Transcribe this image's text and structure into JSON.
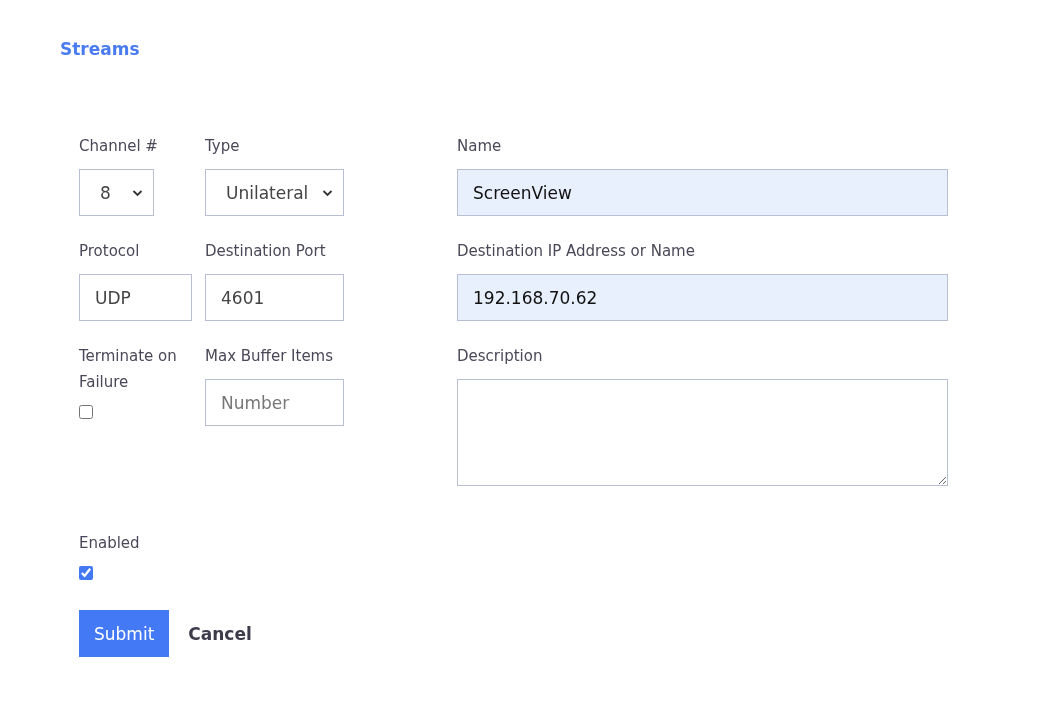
{
  "title": "Streams",
  "left_rows": [
    [
      {
        "label": "Channel #",
        "kind": "select",
        "value": "8"
      },
      {
        "label": "Type",
        "kind": "select",
        "value": "Unilateral"
      }
    ],
    [
      {
        "label": "Protocol",
        "kind": "text",
        "value": "UDP",
        "autofilled": false
      },
      {
        "label": "Destination Port",
        "kind": "text",
        "value": "4601",
        "autofilled": false
      }
    ],
    [
      {
        "label": "Terminate on Failure",
        "kind": "checkbox",
        "checked": false
      },
      {
        "label": "Max Buffer Items",
        "kind": "text",
        "placeholder": "Number",
        "autofilled": false
      }
    ]
  ],
  "right_fields": [
    {
      "label": "Name",
      "kind": "text",
      "value": "ScreenView",
      "autofilled": true
    },
    {
      "label": "Destination IP Address or Name",
      "kind": "text",
      "value": "192.168.70.62",
      "autofilled": true
    },
    {
      "label": "Description",
      "kind": "textarea"
    }
  ],
  "enabled": {
    "label": "Enabled",
    "checked": true
  },
  "buttons": [
    {
      "label": "Submit",
      "kind": "primary"
    },
    {
      "label": "Cancel",
      "kind": "plain"
    }
  ]
}
